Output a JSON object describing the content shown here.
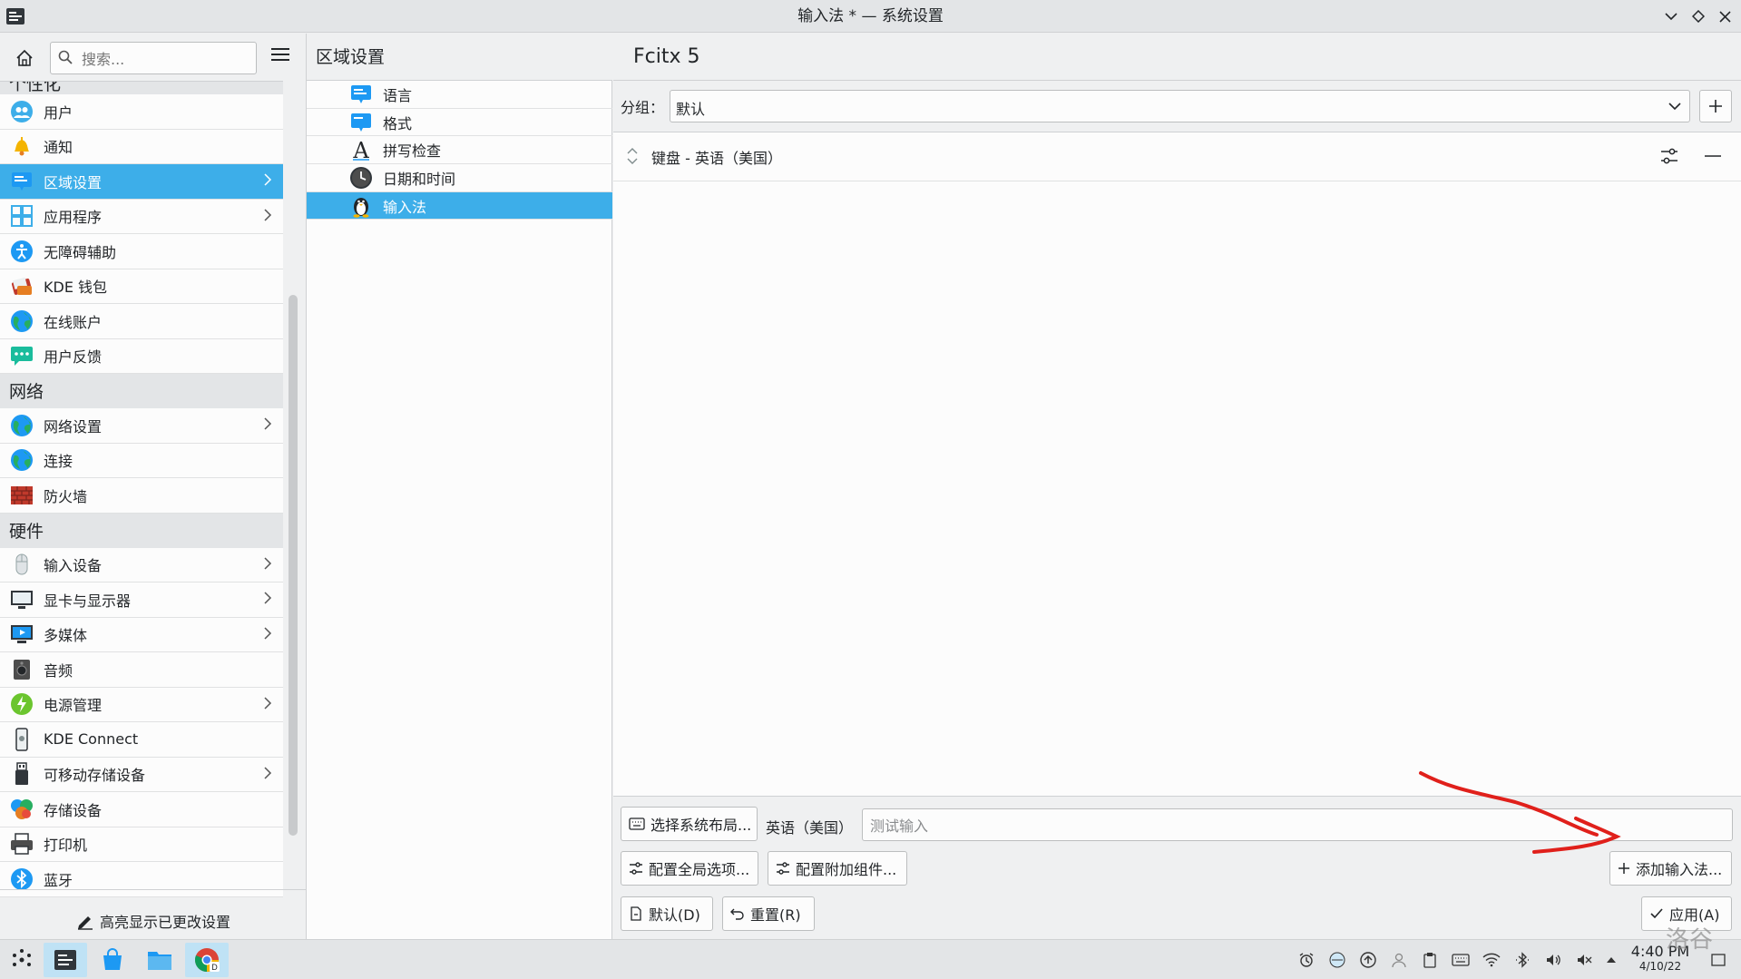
{
  "window": {
    "title": "输入法 * — 系统设置"
  },
  "sidebar": {
    "search_placeholder": "搜索...",
    "partial_category": "个性化",
    "groups": [
      {
        "items": [
          {
            "label": "用户",
            "icon": "users-icon",
            "color": "#3daee9"
          },
          {
            "label": "通知",
            "icon": "bell-icon",
            "color": "#f4b400"
          },
          {
            "label": "区域设置",
            "icon": "region-icon",
            "color": "#1d99f3",
            "selected": true,
            "arrow": true
          },
          {
            "label": "应用程序",
            "icon": "apps-icon",
            "color": "#3daee9",
            "arrow": true
          },
          {
            "label": "无障碍辅助",
            "icon": "accessibility-icon",
            "color": "#1d99f3"
          },
          {
            "label": "KDE 钱包",
            "icon": "wallet-icon",
            "color": "#c0392b"
          },
          {
            "label": "在线账户",
            "icon": "globe-icon",
            "color": "#27ae60"
          },
          {
            "label": "用户反馈",
            "icon": "feedback-icon",
            "color": "#16a085"
          }
        ]
      },
      {
        "category": "网络",
        "items": [
          {
            "label": "网络设置",
            "icon": "network-icon",
            "color": "#27ae60",
            "arrow": true
          },
          {
            "label": "连接",
            "icon": "connection-icon",
            "color": "#27ae60"
          },
          {
            "label": "防火墙",
            "icon": "firewall-icon",
            "color": "#c0392b"
          }
        ]
      },
      {
        "category": "硬件",
        "items": [
          {
            "label": "输入设备",
            "icon": "mouse-icon",
            "color": "#bdc3c7",
            "arrow": true
          },
          {
            "label": "显卡与显示器",
            "icon": "display-icon",
            "color": "#4d4d4d",
            "arrow": true
          },
          {
            "label": "多媒体",
            "icon": "multimedia-icon",
            "color": "#2980b9",
            "arrow": true
          },
          {
            "label": "音频",
            "icon": "audio-icon",
            "color": "#4d4d4d"
          },
          {
            "label": "电源管理",
            "icon": "power-icon",
            "color": "#6bc52e",
            "arrow": true
          },
          {
            "label": "KDE Connect",
            "icon": "phone-icon",
            "color": "#7f8c8d"
          },
          {
            "label": "可移动存储设备",
            "icon": "usb-icon",
            "color": "#4d4d4d",
            "arrow": true
          },
          {
            "label": "存储设备",
            "icon": "storage-icon",
            "color": "#e67e22"
          },
          {
            "label": "打印机",
            "icon": "printer-icon",
            "color": "#4d4d4d"
          },
          {
            "label": "蓝牙",
            "icon": "bluetooth-icon",
            "color": "#1d99f3"
          }
        ]
      }
    ],
    "highlight_label": "高亮显示已更改设置"
  },
  "middle": {
    "title": "区域设置",
    "items": [
      {
        "label": "语言",
        "icon": "language-icon"
      },
      {
        "label": "格式",
        "icon": "formats-icon"
      },
      {
        "label": "拼写检查",
        "icon": "spellcheck-icon"
      },
      {
        "label": "日期和时间",
        "icon": "clock-icon"
      },
      {
        "label": "输入法",
        "icon": "fcitx-penguin-icon",
        "selected": true
      }
    ]
  },
  "main": {
    "title": "Fcitx 5",
    "group_label": "分组：",
    "group_value": "默认",
    "input_methods": [
      {
        "label": "键盘 - 英语（美国）"
      }
    ],
    "select_layout_button": "选择系统布局...",
    "layout_name": "英语（美国）",
    "test_placeholder": "测试输入",
    "global_options_button": "配置全局选项...",
    "addons_button": "配置附加组件...",
    "add_im_button": "添加输入法...",
    "defaults_button": "默认(D)",
    "reset_button": "重置(R)",
    "apply_button": "应用(A)",
    "annotation_color": "#e0201b"
  },
  "taskbar": {
    "time": "4:40 PM",
    "date": "4/10/22",
    "watermark": "洛谷"
  },
  "colors": {
    "accent": "#3daee9",
    "background": "#eff0f1"
  }
}
